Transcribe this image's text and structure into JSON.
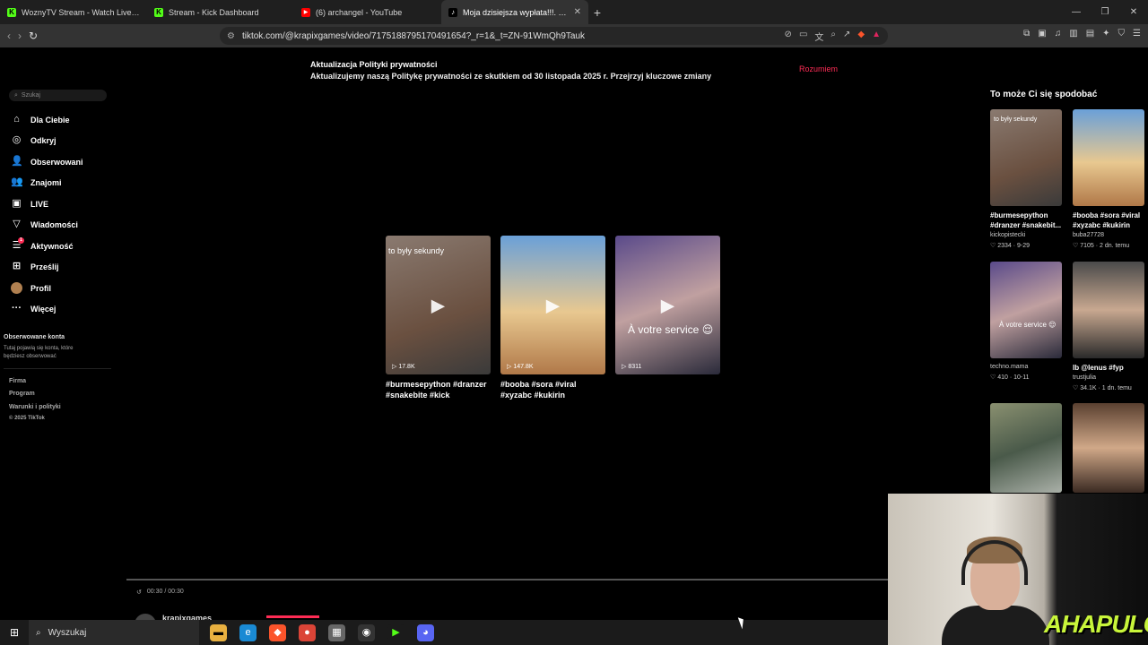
{
  "browser": {
    "tabs": [
      {
        "title": "WoznyTV Stream - Watch Live on Kick",
        "favicon": "K",
        "color": "#53fc18"
      },
      {
        "title": "Stream - Kick Dashboard",
        "favicon": "K",
        "color": "#53fc18"
      },
      {
        "title": "(6) archangel - YouTube",
        "favicon": "▶",
        "color": "#ff0000"
      },
      {
        "title": "Moja dzisiejsza wypłata!!!. #polsk",
        "favicon": "♪",
        "color": "#ffffff"
      }
    ],
    "new_tab": "+",
    "url": "tiktok.com/@krapixgames/video/7175188795170491654?_r=1&_t=ZN-91WmQh9Tauk"
  },
  "sidebar": {
    "search_placeholder": "Szukaj",
    "items": [
      {
        "label": "Dla Ciebie",
        "icon": "⌂"
      },
      {
        "label": "Odkryj",
        "icon": "◎"
      },
      {
        "label": "Obserwowani",
        "icon": "👤"
      },
      {
        "label": "Znajomi",
        "icon": "👥"
      },
      {
        "label": "LIVE",
        "icon": "▣"
      },
      {
        "label": "Wiadomości",
        "icon": "▽"
      },
      {
        "label": "Aktywność",
        "icon": "☰",
        "badge": "1"
      },
      {
        "label": "Prześlij",
        "icon": "⊞"
      },
      {
        "label": "Profil",
        "icon": ""
      },
      {
        "label": "Więcej",
        "icon": "···"
      }
    ],
    "followed_title": "Obserwowane konta",
    "followed_desc": "Tutaj pojawią się konta, które będziesz obserwować",
    "footer": [
      "Firma",
      "Program",
      "Warunki i polityki",
      "© 2025 TikTok"
    ]
  },
  "notice": {
    "title": "Aktualizacja Polityki prywatności",
    "text": "Aktualizujemy naszą Politykę prywatności ze skutkiem od 30 listopada 2025 r. Przejrzyj kluczowe zmiany",
    "button": "Rozumiem"
  },
  "videos": [
    {
      "caption_overlay": "to były sekundy",
      "views": "17.8K",
      "desc": "#burmesepython #dranzer #snakebite #kick",
      "bg": "linear-gradient(160deg,#8a7a70,#6a5040 60,#3a3a3a)"
    },
    {
      "caption_overlay": "",
      "views": "147.8K",
      "desc": "#booba #sora #viral #xyzabc #kukirin",
      "bg": "linear-gradient(180deg,#6aa0d8,#e8c890 55%,#b07848)"
    },
    {
      "caption_overlay": "À votre service 😌",
      "views": "8311",
      "desc": "",
      "bg": "linear-gradient(160deg,#5a4a8a,#c0a0a0 50%,#2a2a3a)"
    }
  ],
  "reco": {
    "title": "To może Ci się spodobać",
    "items": [
      {
        "caption": "to były sekundy",
        "overlay": "",
        "desc": "#burmesepython #dranzer #snakebit...",
        "author": "kickopistecki",
        "meta": "♡ 2334 · 9-29"
      },
      {
        "caption": "",
        "overlay": "",
        "desc": "#booba #sora #viral #xyzabc #kukirin",
        "author": "buba27728",
        "meta": "♡ 7105 · 2 dn. temu"
      },
      {
        "caption": "",
        "overlay": "À votre service 😌",
        "desc": "",
        "author": "techno.mama",
        "meta": "♡ 410 · 10-11"
      },
      {
        "caption": "",
        "overlay": "",
        "desc": "lb @lenus #fyp",
        "author": "trustjulia",
        "meta": "♡ 34.1K · 1 dn. temu"
      },
      {
        "caption": "",
        "overlay": "",
        "desc": "",
        "author": "",
        "meta": ""
      },
      {
        "caption": "",
        "overlay": "",
        "desc": "",
        "author": "",
        "meta": ""
      }
    ]
  },
  "player": {
    "time": "00:30 / 00:30",
    "author": "krapixgames"
  },
  "taskbar": {
    "search_label": "Wyszukaj"
  },
  "webcam": {
    "logo": "AHAPULCO"
  }
}
